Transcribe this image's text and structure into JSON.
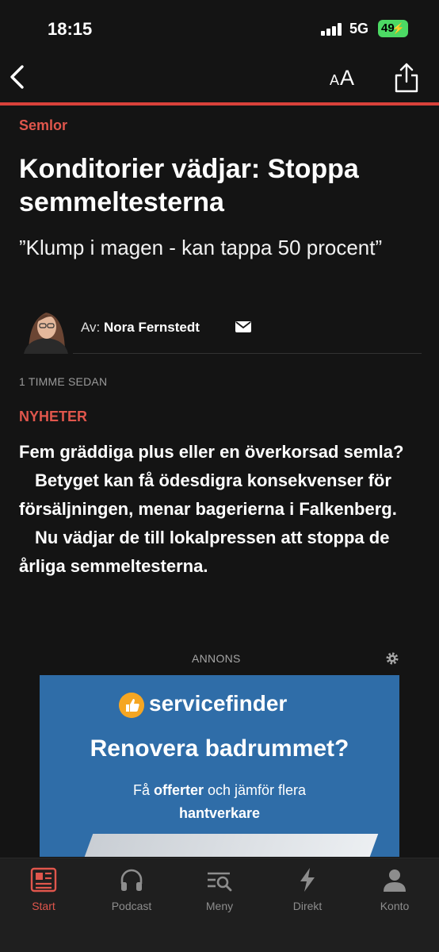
{
  "status_bar": {
    "time": "18:15",
    "network": "5G",
    "battery": "49"
  },
  "app_bar": {
    "text_size_small": "A",
    "text_size_large": "A"
  },
  "article": {
    "kicker": "Semlor",
    "headline": "Konditorier vädjar: Stoppa semmeltesterna",
    "subheadline": "”Klump i magen - kan tappa 50 procent”",
    "byline_prefix": "Av:",
    "author": "Nora Fernstedt",
    "timestamp": "1 TIMME SEDAN",
    "section": "NYHETER",
    "lead": [
      "Fem gräddiga plus eller en överkorsad semla?",
      "Betyget kan få ödesdigra konsekvenser för försäljningen, menar bagerierna i Falkenberg.",
      "Nu vädjar de till lokalpressen att stoppa de årliga semmeltesterna."
    ]
  },
  "ad": {
    "label": "ANNONS",
    "brand": "servicefinder",
    "title": "Renovera badrummet?",
    "sub_prefix": "Få ",
    "sub_bold": "offerter",
    "sub_suffix": " och jämför flera",
    "sub_line2": "hantverkare"
  },
  "tabbar": {
    "items": [
      {
        "label": "Start",
        "icon": "newspaper-icon",
        "active": true
      },
      {
        "label": "Podcast",
        "icon": "headphones-icon",
        "active": false
      },
      {
        "label": "Meny",
        "icon": "menu-search-icon",
        "active": false
      },
      {
        "label": "Direkt",
        "icon": "lightning-icon",
        "active": false
      },
      {
        "label": "Konto",
        "icon": "person-icon",
        "active": false
      }
    ]
  },
  "colors": {
    "accent": "#d8413a",
    "background": "#141414",
    "ad_background": "#2f6da8"
  }
}
